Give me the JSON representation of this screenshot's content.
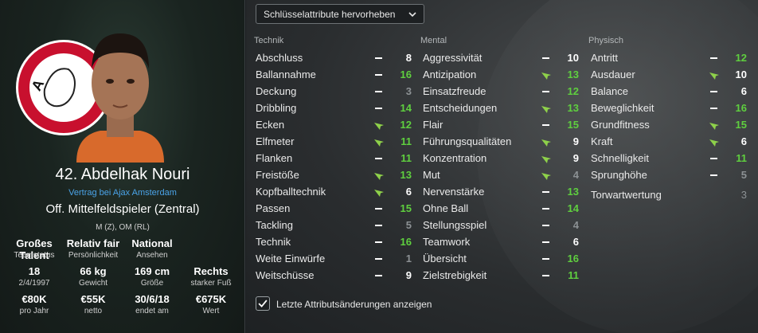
{
  "profile": {
    "name": "42. Abdelhak Nouri",
    "contract": "Vertrag bei Ajax Amsterdam",
    "position": "Off. Mittelfeldspieler (Zentral)",
    "positions_short": "M (Z), OM (RL)",
    "crest_text": "AJAX",
    "stats": [
      {
        "value": "Großes Talent",
        "label": "Teamstatus"
      },
      {
        "value": "Relativ fair",
        "label": "Persönlichkeit"
      },
      {
        "value": "National",
        "label": "Ansehen"
      },
      {
        "value": "",
        "label": ""
      },
      {
        "value": "18",
        "label": "2/4/1997"
      },
      {
        "value": "66 kg",
        "label": "Gewicht"
      },
      {
        "value": "169 cm",
        "label": "Größe"
      },
      {
        "value": "Rechts",
        "label": "starker Fuß"
      },
      {
        "value": "€80K",
        "label": "pro Jahr"
      },
      {
        "value": "€55K",
        "label": "netto"
      },
      {
        "value": "30/6/18",
        "label": "endet am"
      },
      {
        "value": "€675K",
        "label": "Wert"
      }
    ]
  },
  "attributes": {
    "highlight_dropdown": "Schlüsselattribute hervorheben",
    "show_changes_label": "Letzte Attributsänderungen anzeigen",
    "show_changes_checked": true,
    "colors": {
      "green": "#5fcf3f",
      "white": "#ffffff",
      "grey": "#8c9194",
      "arrow": "#8ed14a"
    },
    "columns": [
      {
        "heading": "Technik",
        "rows": [
          {
            "name": "Abschluss",
            "value": "8",
            "trend": "flat",
            "color": "white"
          },
          {
            "name": "Ballannahme",
            "value": "16",
            "trend": "flat",
            "color": "green"
          },
          {
            "name": "Deckung",
            "value": "3",
            "trend": "flat",
            "color": "grey"
          },
          {
            "name": "Dribbling",
            "value": "14",
            "trend": "flat",
            "color": "green"
          },
          {
            "name": "Ecken",
            "value": "12",
            "trend": "up",
            "color": "green"
          },
          {
            "name": "Elfmeter",
            "value": "11",
            "trend": "up",
            "color": "green"
          },
          {
            "name": "Flanken",
            "value": "11",
            "trend": "flat",
            "color": "green"
          },
          {
            "name": "Freistöße",
            "value": "13",
            "trend": "up",
            "color": "green"
          },
          {
            "name": "Kopfballtechnik",
            "value": "6",
            "trend": "up",
            "color": "white"
          },
          {
            "name": "Passen",
            "value": "15",
            "trend": "flat",
            "color": "green"
          },
          {
            "name": "Tackling",
            "value": "5",
            "trend": "flat",
            "color": "grey"
          },
          {
            "name": "Technik",
            "value": "16",
            "trend": "flat",
            "color": "green"
          },
          {
            "name": "Weite Einwürfe",
            "value": "1",
            "trend": "flat",
            "color": "grey"
          },
          {
            "name": "Weitschüsse",
            "value": "9",
            "trend": "flat",
            "color": "white"
          }
        ]
      },
      {
        "heading": "Mental",
        "rows": [
          {
            "name": "Aggressivität",
            "value": "10",
            "trend": "flat",
            "color": "white"
          },
          {
            "name": "Antizipation",
            "value": "13",
            "trend": "up",
            "color": "green"
          },
          {
            "name": "Einsatzfreude",
            "value": "12",
            "trend": "flat",
            "color": "green"
          },
          {
            "name": "Entscheidungen",
            "value": "13",
            "trend": "up",
            "color": "green"
          },
          {
            "name": "Flair",
            "value": "15",
            "trend": "flat",
            "color": "green"
          },
          {
            "name": "Führungsqualitäten",
            "value": "9",
            "trend": "up",
            "color": "white"
          },
          {
            "name": "Konzentration",
            "value": "9",
            "trend": "up",
            "color": "white"
          },
          {
            "name": "Mut",
            "value": "4",
            "trend": "up",
            "color": "grey"
          },
          {
            "name": "Nervenstärke",
            "value": "13",
            "trend": "flat",
            "color": "green"
          },
          {
            "name": "Ohne Ball",
            "value": "14",
            "trend": "flat",
            "color": "green"
          },
          {
            "name": "Stellungsspiel",
            "value": "4",
            "trend": "flat",
            "color": "grey"
          },
          {
            "name": "Teamwork",
            "value": "6",
            "trend": "flat",
            "color": "white"
          },
          {
            "name": "Übersicht",
            "value": "16",
            "trend": "flat",
            "color": "green"
          },
          {
            "name": "Zielstrebigkeit",
            "value": "11",
            "trend": "flat",
            "color": "green"
          }
        ]
      },
      {
        "heading": "Physisch",
        "rows": [
          {
            "name": "Antritt",
            "value": "12",
            "trend": "flat",
            "color": "green"
          },
          {
            "name": "Ausdauer",
            "value": "10",
            "trend": "up",
            "color": "white"
          },
          {
            "name": "Balance",
            "value": "6",
            "trend": "flat",
            "color": "white"
          },
          {
            "name": "Beweglichkeit",
            "value": "16",
            "trend": "flat",
            "color": "green"
          },
          {
            "name": "Grundfitness",
            "value": "15",
            "trend": "up",
            "color": "green"
          },
          {
            "name": "Kraft",
            "value": "6",
            "trend": "up",
            "color": "white"
          },
          {
            "name": "Schnelligkeit",
            "value": "11",
            "trend": "flat",
            "color": "green"
          },
          {
            "name": "Sprunghöhe",
            "value": "5",
            "trend": "flat",
            "color": "grey"
          }
        ],
        "extra": {
          "name": "Torwartwertung",
          "value": "3",
          "color": "grey"
        }
      }
    ]
  }
}
